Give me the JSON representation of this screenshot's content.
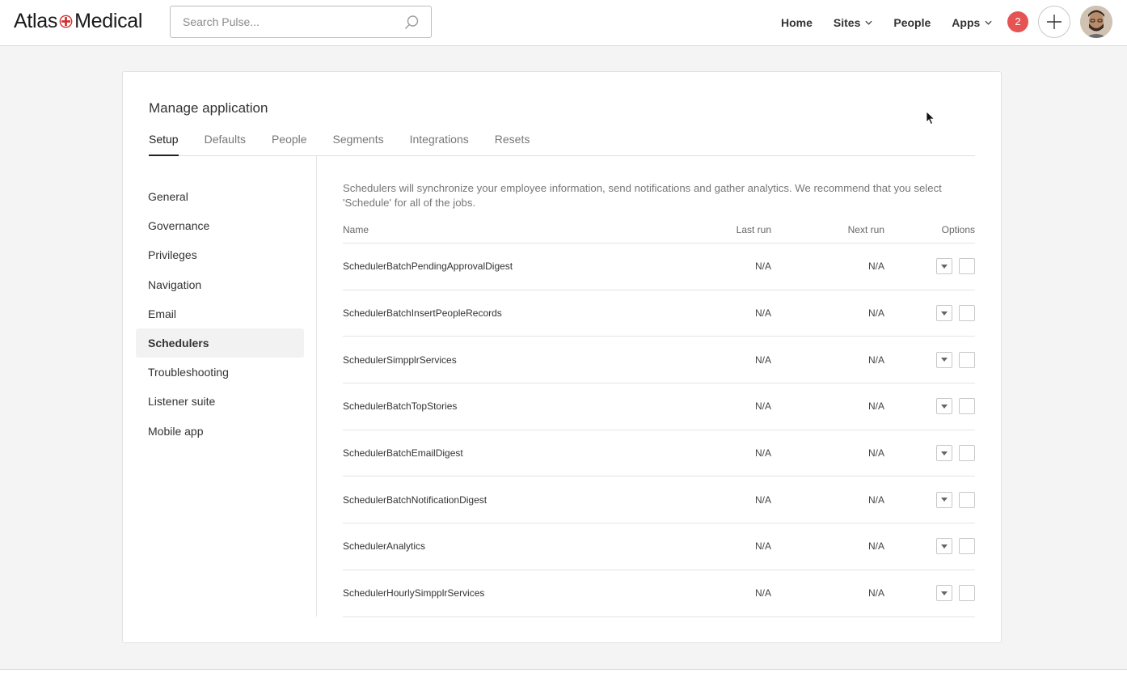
{
  "header": {
    "logo_left": "Atlas",
    "logo_right": "Medical",
    "search_placeholder": "Search Pulse...",
    "nav": [
      {
        "label": "Home"
      },
      {
        "label": "Sites"
      },
      {
        "label": "People"
      },
      {
        "label": "Apps"
      }
    ],
    "notification_count": "2"
  },
  "page": {
    "title": "Manage application",
    "tabs": [
      {
        "label": "Setup"
      },
      {
        "label": "Defaults"
      },
      {
        "label": "People"
      },
      {
        "label": "Segments"
      },
      {
        "label": "Integrations"
      },
      {
        "label": "Resets"
      }
    ],
    "sidebar": [
      {
        "label": "General"
      },
      {
        "label": "Governance"
      },
      {
        "label": "Privileges"
      },
      {
        "label": "Navigation"
      },
      {
        "label": "Email"
      },
      {
        "label": "Schedulers"
      },
      {
        "label": "Troubleshooting"
      },
      {
        "label": "Listener suite"
      },
      {
        "label": "Mobile app"
      }
    ],
    "intro": "Schedulers will synchronize your employee information, send notifications and gather analytics. We recommend that you select 'Schedule' for all of the jobs.",
    "table": {
      "columns": {
        "name": "Name",
        "last_run": "Last run",
        "next_run": "Next run",
        "options": "Options"
      },
      "rows": [
        {
          "name": "SchedulerBatchPendingApprovalDigest",
          "last_run": "N/A",
          "next_run": "N/A"
        },
        {
          "name": "SchedulerBatchInsertPeopleRecords",
          "last_run": "N/A",
          "next_run": "N/A"
        },
        {
          "name": "SchedulerSimpplrServices",
          "last_run": "N/A",
          "next_run": "N/A"
        },
        {
          "name": "SchedulerBatchTopStories",
          "last_run": "N/A",
          "next_run": "N/A"
        },
        {
          "name": "SchedulerBatchEmailDigest",
          "last_run": "N/A",
          "next_run": "N/A"
        },
        {
          "name": "SchedulerBatchNotificationDigest",
          "last_run": "N/A",
          "next_run": "N/A"
        },
        {
          "name": "SchedulerAnalytics",
          "last_run": "N/A",
          "next_run": "N/A"
        },
        {
          "name": "SchedulerHourlySimpplrServices",
          "last_run": "N/A",
          "next_run": "N/A"
        }
      ]
    }
  },
  "colors": {
    "logo_accent": "#d0312d",
    "badge": "#e55353"
  },
  "icons": {
    "search": "search-icon",
    "chevron": "chevron-down-icon",
    "add": "plus-icon",
    "dropdown": "caret-down-icon"
  }
}
